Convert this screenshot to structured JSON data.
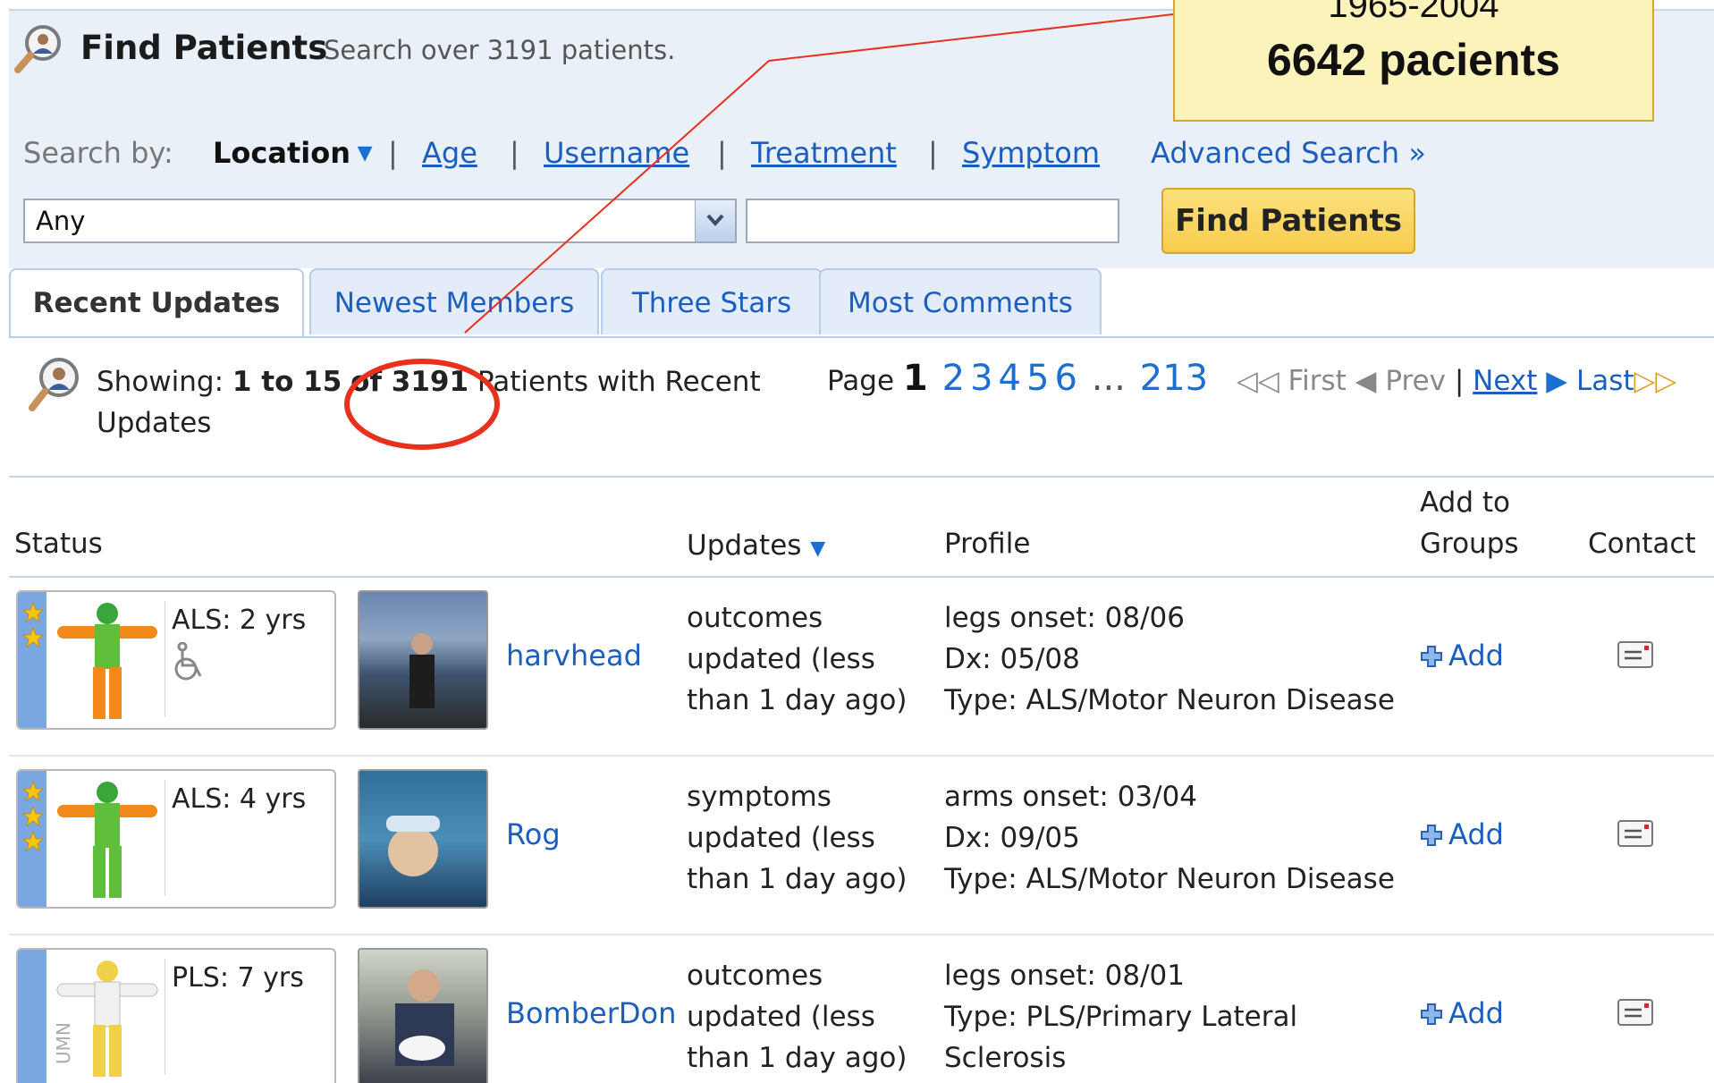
{
  "header": {
    "title": "Find Patients",
    "subtitle": "Search over 3191 patients."
  },
  "search": {
    "label": "Search by:",
    "options": {
      "location": "Location",
      "age": "Age",
      "username": "Username",
      "treatment": "Treatment",
      "symptom": "Symptom"
    },
    "separator": "|",
    "advanced": "Advanced Search »",
    "select_value": "Any",
    "text_value": "",
    "button": "Find Patients"
  },
  "tabs": [
    {
      "label": "Recent Updates",
      "active": true
    },
    {
      "label": "Newest Members",
      "active": false
    },
    {
      "label": "Three Stars",
      "active": false
    },
    {
      "label": "Most Comments",
      "active": false
    }
  ],
  "showing": {
    "prefix": "Showing:",
    "range": "1 to 15",
    "of": "of 3191",
    "suffix": "Patients with Recent Updates"
  },
  "pager": {
    "page_label": "Page",
    "current": "1",
    "pages": [
      "2",
      "3",
      "4",
      "5",
      "6"
    ],
    "ellipsis": "...",
    "last_page": "213",
    "first": "First",
    "prev": "Prev",
    "divider": "|",
    "next": "Next",
    "last": "Last"
  },
  "table": {
    "headers": {
      "status": "Status",
      "updates": "Updates",
      "profile": "Profile",
      "add_to_groups_1": "Add to",
      "add_to_groups_2": "Groups",
      "contact": "Contact"
    },
    "rows": [
      {
        "condition": "ALS: 2 yrs",
        "stars": 2,
        "wheelchair": true,
        "username": "harvhead",
        "updates": "outcomes updated (less than 1 day ago)",
        "profile_1": "legs onset: 08/06",
        "profile_2": "Dx: 05/08",
        "profile_3": "Type: ALS/Motor Neuron Disease",
        "add": "Add"
      },
      {
        "condition": "ALS: 4 yrs",
        "stars": 3,
        "wheelchair": false,
        "username": "Rog",
        "updates": "symptoms updated (less than 1 day ago)",
        "profile_1": "arms onset: 03/04",
        "profile_2": "Dx: 09/05",
        "profile_3": "Type: ALS/Motor Neuron Disease",
        "add": "Add"
      },
      {
        "condition": "PLS: 7 yrs",
        "stars": 0,
        "wheelchair": false,
        "username": "BomberDon",
        "updates": "outcomes updated (less than 1 day ago)",
        "profile_1": "legs onset: 08/01",
        "profile_2": "Type: PLS/Primary Lateral",
        "profile_3": "Sclerosis",
        "add": "Add",
        "figure_tag": "UMN"
      }
    ]
  },
  "annotation": {
    "line1": "1965-2004",
    "line2": "6642 pacients"
  },
  "colors": {
    "link": "#1a5fbf",
    "header_bg": "#e9f0f8",
    "button": "#f7cc4d",
    "annotation_red": "#e8301c",
    "callout_bg": "#fbf3b9"
  }
}
